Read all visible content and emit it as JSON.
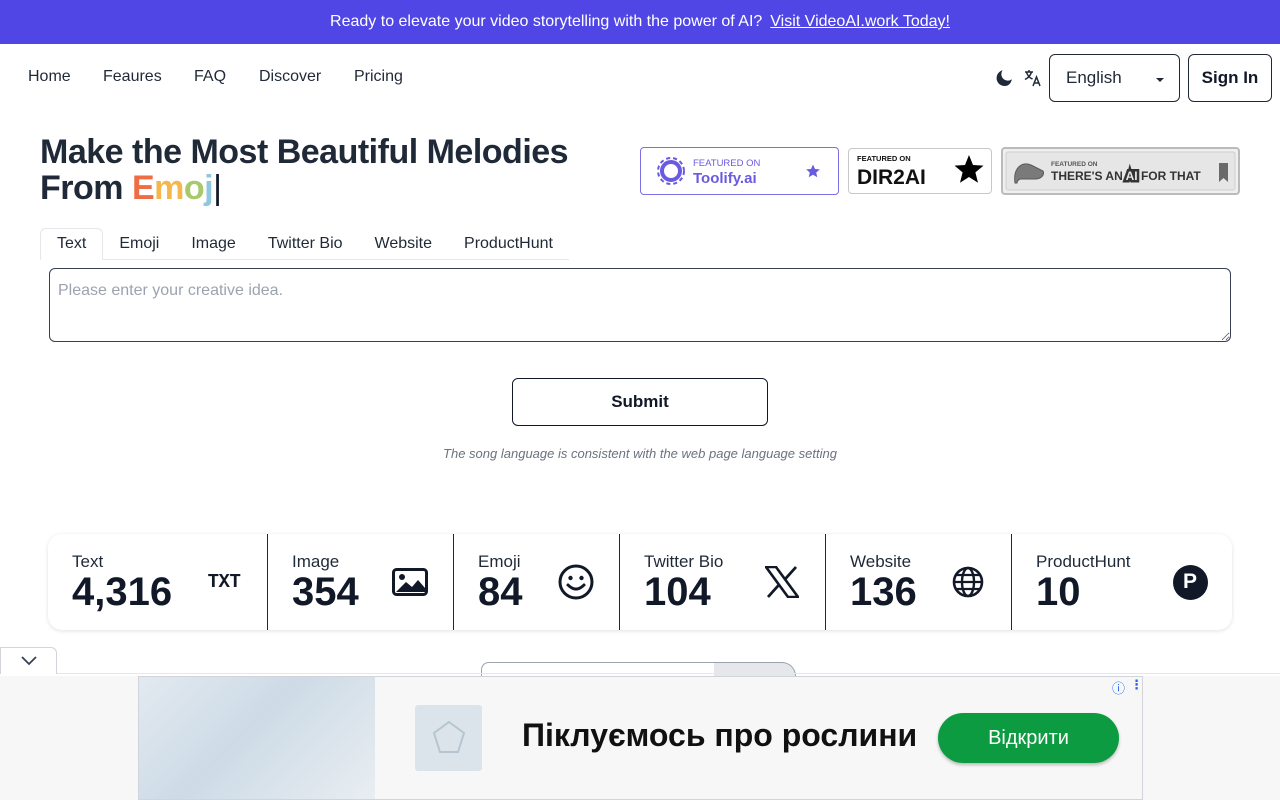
{
  "banner": {
    "text": "Ready to elevate your video storytelling with the power of AI?",
    "link": "Visit VideoAI.work Today!"
  },
  "nav": {
    "links": [
      "Home",
      "Feaures",
      "FAQ",
      "Discover",
      "Pricing"
    ],
    "language": "English",
    "sign_in": "Sign In"
  },
  "hero": {
    "line1": "Make the Most Beautiful Melodies",
    "line2_prefix": "From ",
    "typed": [
      "E",
      "m",
      "o",
      "j"
    ],
    "cursor": "|"
  },
  "badges": {
    "toolify": {
      "top": "FEATURED ON",
      "name": "Toolify.ai"
    },
    "dir2ai": {
      "top": "FEATURED ON",
      "name": "DIR2AI"
    },
    "taaft": {
      "top": "FEATURED ON",
      "name_a": "THERE'S AN",
      "name_ai": "AI",
      "name_b": "FOR THAT"
    }
  },
  "tabs": [
    "Text",
    "Emoji",
    "Image",
    "Twitter Bio",
    "Website",
    "ProductHunt"
  ],
  "active_tab": "Text",
  "input": {
    "placeholder": "Please enter your creative idea.",
    "value": ""
  },
  "submit_label": "Submit",
  "note": "The song language is consistent with the web page language setting",
  "stats": [
    {
      "label": "Text",
      "value": "4,316",
      "icon": "txt-icon"
    },
    {
      "label": "Image",
      "value": "354",
      "icon": "image-icon"
    },
    {
      "label": "Emoji",
      "value": "84",
      "icon": "smiley-icon"
    },
    {
      "label": "Twitter Bio",
      "value": "104",
      "icon": "x-logo-icon"
    },
    {
      "label": "Website",
      "value": "136",
      "icon": "globe-icon"
    },
    {
      "label": "ProductHunt",
      "value": "10",
      "icon": "producthunt-icon"
    }
  ],
  "txt_icon_text": "TXT",
  "ph_icon_text": "P",
  "ad": {
    "headline": "Піклуємось про рослини",
    "cta": "Відкрити"
  },
  "colors": {
    "banner": "#4f46e5",
    "accent_purple": "#6a5ae0",
    "ad_cta": "#0d9b42"
  }
}
